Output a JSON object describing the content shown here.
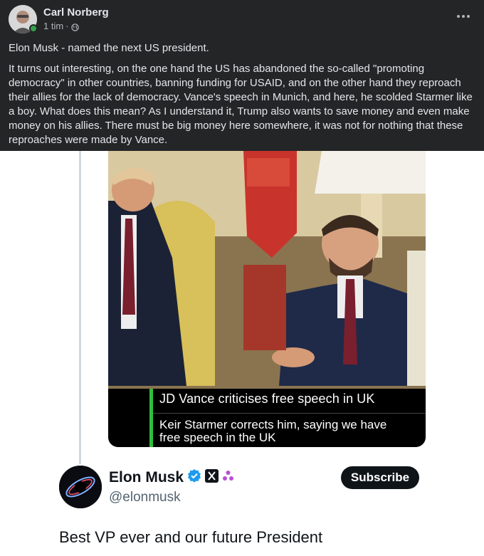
{
  "post": {
    "author": "Carl Norberg",
    "time": "1 tim",
    "separator": "·",
    "visibility_icon": "globe-icon",
    "paragraphs": [
      "Elon Musk - named the next US president.",
      "It turns out interesting, on the one hand the US has abandoned the so-called \"promoting democracy\" in other countries, banning funding for USAID, and on the other hand they reproach their allies for the lack of democracy. Vance's speech in Munich, and here, he scolded Starmer like a boy. What does this mean? As I understand it, Trump also wants to save money and even make money on his allies. There must be big money here somewhere, it was not for nothing that these reproaches were made by Vance."
    ]
  },
  "video": {
    "caption_line1": "JD Vance criticises free speech in UK",
    "caption_line2": "Keir Starmer corrects him, saying we have free speech in the UK"
  },
  "tweet": {
    "name": "Elon Musk",
    "handle": "@elonmusk",
    "subscribe_label": "Subscribe",
    "text": "Best VP ever and our future President",
    "badges": [
      "verified-icon",
      "x-logo-icon",
      "affiliate-icon"
    ]
  },
  "colors": {
    "card_bg": "#242526",
    "online": "#31a24c",
    "verified": "#1d9bf0",
    "caption_accent": "#2fbf3a"
  }
}
